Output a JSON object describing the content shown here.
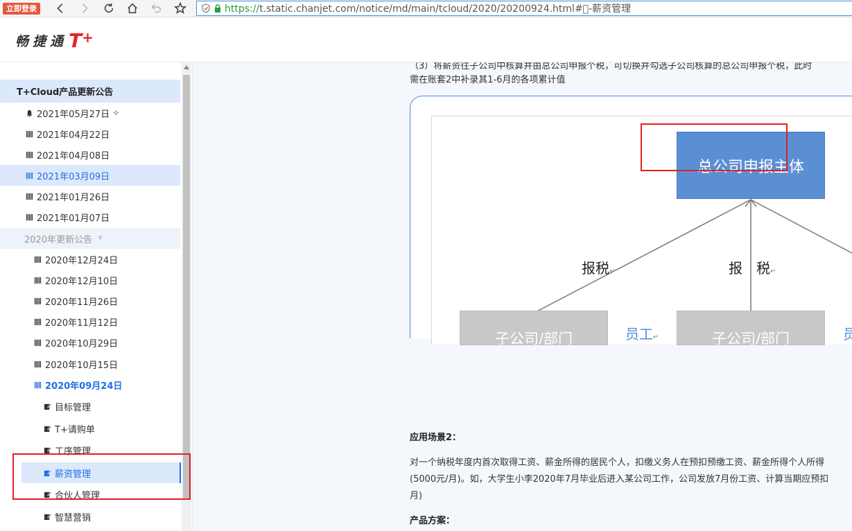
{
  "browser": {
    "login_badge": "立即登录",
    "url_scheme": "https://",
    "url_rest": "t.static.chanjet.com/notice/md/main/tcloud/2020/20200924.html#\u0000-薪资管理"
  },
  "site": {
    "logo_cn": "畅捷通",
    "logo_t": "T",
    "logo_plus": "+"
  },
  "sidebar": {
    "section_title": "T+Cloud产品更新公告",
    "items_2021": [
      {
        "label": "2021年05月27日",
        "sparkle": "✧"
      },
      {
        "label": "2021年04月22日"
      },
      {
        "label": "2021年04月08日"
      },
      {
        "label": "2021年03月09日"
      },
      {
        "label": "2021年01月26日"
      },
      {
        "label": "2021年01月07日"
      }
    ],
    "group_2020": "2020年更新公告",
    "items_2020": [
      {
        "label": "2020年12月24日"
      },
      {
        "label": "2020年12月10日"
      },
      {
        "label": "2020年11月26日"
      },
      {
        "label": "2020年11月12日"
      },
      {
        "label": "2020年10月29日"
      },
      {
        "label": "2020年10月15日"
      },
      {
        "label": "2020年09月24日"
      }
    ],
    "sub_items": [
      {
        "label": "目标管理"
      },
      {
        "label": "T+请购单"
      },
      {
        "label": "工序管理"
      },
      {
        "label": "薪资管理"
      },
      {
        "label": "合伙人管理"
      },
      {
        "label": "智慧营销"
      }
    ]
  },
  "content": {
    "top_partial": "（3）将薪资往子公司中核算并由总公司申报个税，可切换并勾选子公司核算的总公司申报个税，此时",
    "top_line2": "需在账套2中补录其1-6月的各项累计值",
    "diagram": {
      "main_box": "总公司申报主体",
      "tax_label_left": "报税",
      "tax_label_mid": "报　税",
      "sub_box_left": "子公司/部门",
      "sub_box_mid": "子公司/部门",
      "emp_label_left": "员工",
      "emp_label_right": "员",
      "return_mark": "↵"
    },
    "scene_title": "应用场景2：",
    "para_line1": "对一个纳税年度内首次取得工资、薪金所得的居民个人，扣缴义务人在预扣预缴工资、薪金所得个人所得",
    "para_line2": "(5000元/月)。如，大学生小李2020年7月毕业后进入某公司工作，公司发放7月份工资、计算当期应预扣",
    "para_line3": "月)",
    "plan_title": "产品方案："
  }
}
